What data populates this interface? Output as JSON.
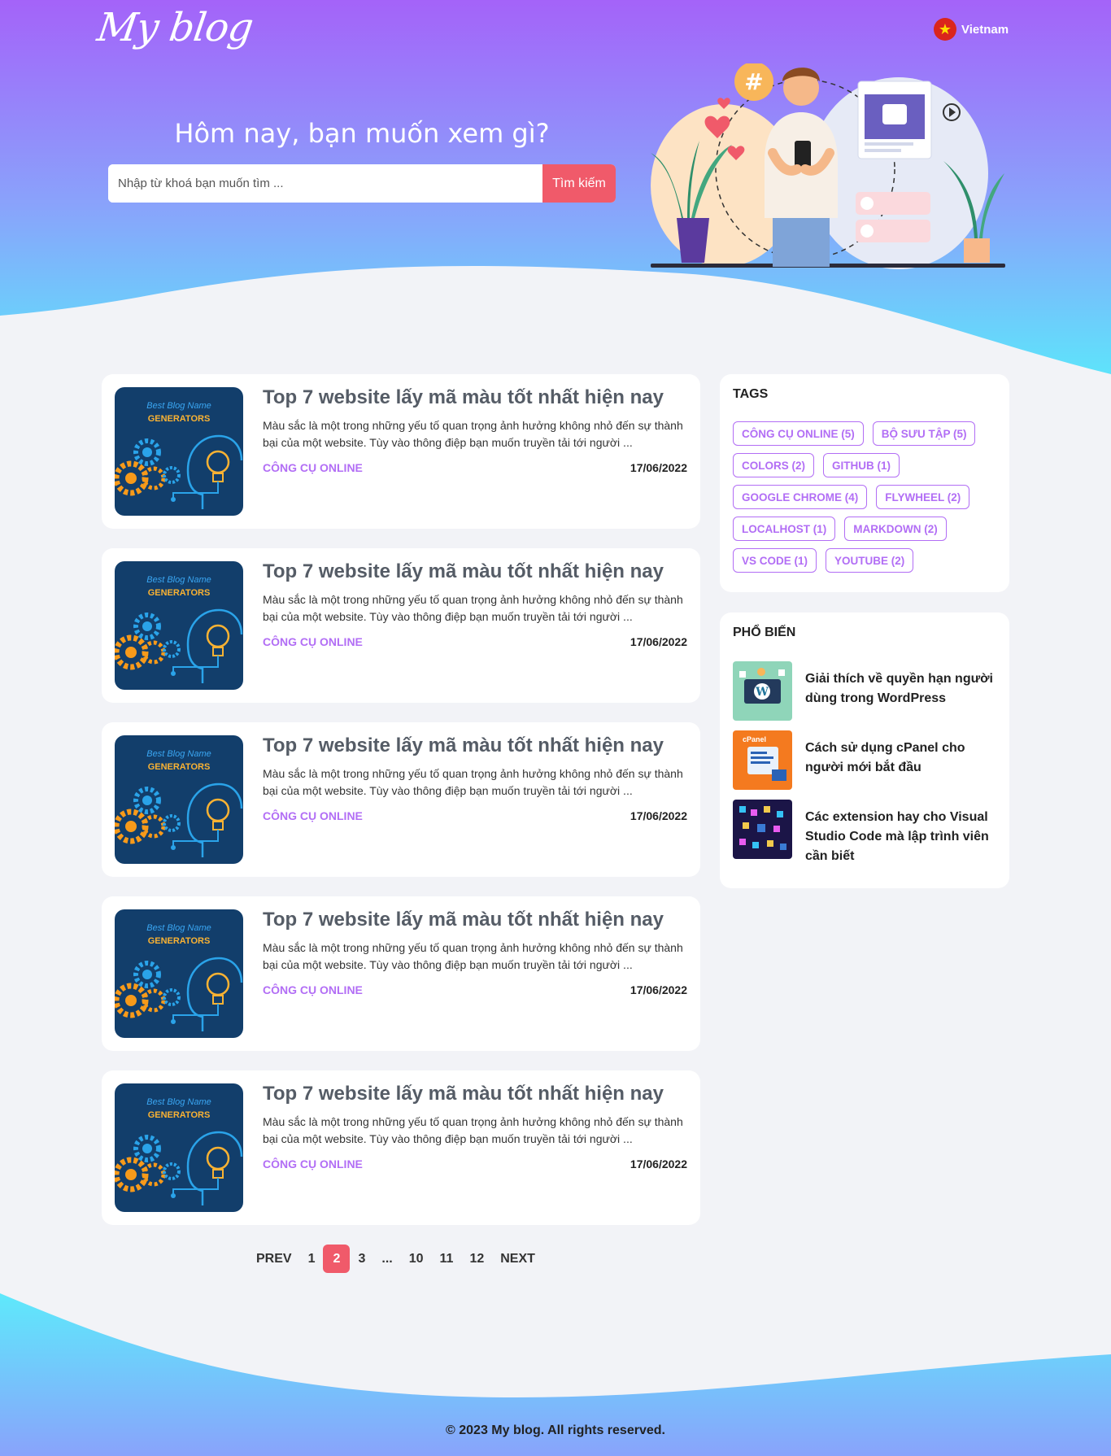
{
  "header": {
    "logo": "My blog",
    "language": "Vietnam",
    "title": "Hôm nay, bạn muốn xem gì?",
    "search_placeholder": "Nhập từ khoá bạn muốn tìm ...",
    "search_button": "Tìm kiếm"
  },
  "thumbnail": {
    "line1": "Best Blog Name",
    "line2": "GENERATORS"
  },
  "posts": [
    {
      "title": "Top 7 website lấy mã màu tốt nhất hiện nay",
      "excerpt": "Màu sắc là một trong những yếu tố quan trọng ảnh hưởng không nhỏ đến sự thành bại của một website. Tùy vào thông điệp bạn muốn truyền tải tới người ...",
      "category": "CÔNG CỤ ONLINE",
      "date": "17/06/2022"
    },
    {
      "title": "Top 7 website lấy mã màu tốt nhất hiện nay",
      "excerpt": "Màu sắc là một trong những yếu tố quan trọng ảnh hưởng không nhỏ đến sự thành bại của một website. Tùy vào thông điệp bạn muốn truyền tải tới người ...",
      "category": "CÔNG CỤ ONLINE",
      "date": "17/06/2022"
    },
    {
      "title": "Top 7 website lấy mã màu tốt nhất hiện nay",
      "excerpt": "Màu sắc là một trong những yếu tố quan trọng ảnh hưởng không nhỏ đến sự thành bại của một website. Tùy vào thông điệp bạn muốn truyền tải tới người ...",
      "category": "CÔNG CỤ ONLINE",
      "date": "17/06/2022"
    },
    {
      "title": "Top 7 website lấy mã màu tốt nhất hiện nay",
      "excerpt": "Màu sắc là một trong những yếu tố quan trọng ảnh hưởng không nhỏ đến sự thành bại của một website. Tùy vào thông điệp bạn muốn truyền tải tới người ...",
      "category": "CÔNG CỤ ONLINE",
      "date": "17/06/2022"
    },
    {
      "title": "Top 7 website lấy mã màu tốt nhất hiện nay",
      "excerpt": "Màu sắc là một trong những yếu tố quan trọng ảnh hưởng không nhỏ đến sự thành bại của một website. Tùy vào thông điệp bạn muốn truyền tải tới người ...",
      "category": "CÔNG CỤ ONLINE",
      "date": "17/06/2022"
    }
  ],
  "pagination": {
    "prev": "PREV",
    "pages": [
      "1",
      "2",
      "3",
      "...",
      "10",
      "11",
      "12"
    ],
    "current": "2",
    "next": "NEXT"
  },
  "sidebar": {
    "tags_title": "TAGS",
    "tags": [
      "CÔNG CỤ ONLINE (5)",
      "BỘ SƯU TẬP (5)",
      "COLORS (2)",
      "GITHUB (1)",
      "GOOGLE CHROME (4)",
      "FLYWHEEL (2)",
      "LOCALHOST (1)",
      "MARKDOWN (2)",
      "VS CODE (1)",
      "YOUTUBE (2)"
    ],
    "popular_title": "PHỔ BIẾN",
    "popular": [
      {
        "title": "Giải thích về quyền hạn người dùng trong WordPress",
        "icon": "wordpress-thumb"
      },
      {
        "title": "Cách sử dụng cPanel cho người mới bắt đầu",
        "icon": "cpanel-thumb"
      },
      {
        "title": "Các extension hay cho Visual Studio Code mà lập trình viên cần biết",
        "icon": "vscode-thumb"
      }
    ]
  },
  "footer": {
    "copyright": "© 2023 My blog. All rights reserved."
  },
  "colors": {
    "accent": "#f05a6a",
    "tag": "#b26ef5",
    "hero_top": "#a463f9",
    "hero_bottom": "#5ee3fb"
  }
}
